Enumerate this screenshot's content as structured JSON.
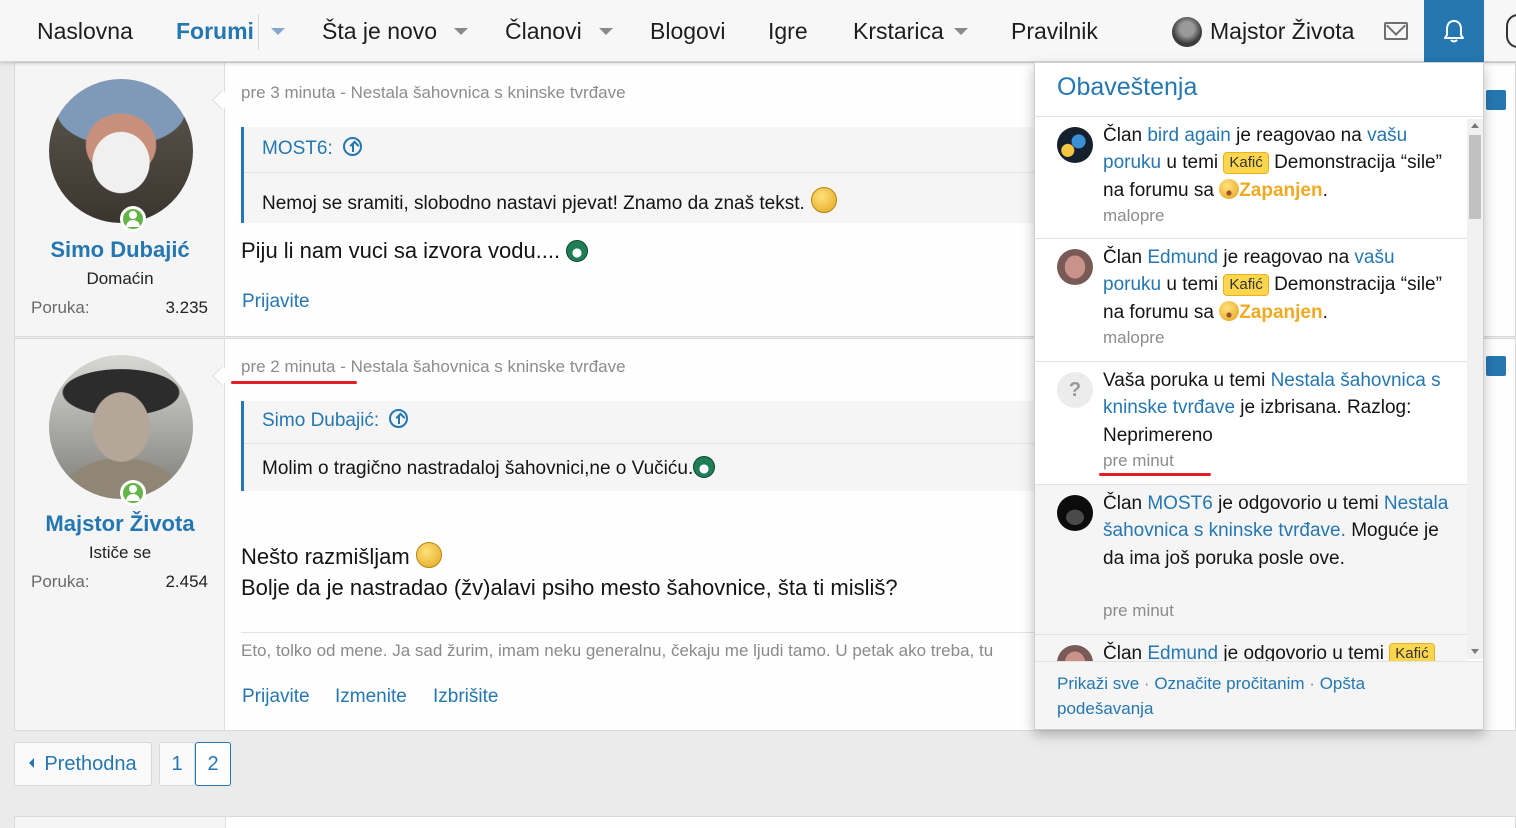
{
  "nav": {
    "items": [
      "Naslovna",
      "Forumi",
      "Šta je novo",
      "Članovi",
      "Blogovi",
      "Igre",
      "Krstarica",
      "Pravilnik"
    ],
    "user_name": "Majstor Života"
  },
  "posts": [
    {
      "author": "Simo Dubajić",
      "title": "Domaćin",
      "stat_label": "Poruka:",
      "stat_value": "3.235",
      "meta": "pre 3 minuta - Nestala šahovnica s kninske tvrđave",
      "quote_author": "MOST6:",
      "quote_text": "Nemoj se sramiti, slobodno nastavi pjevat! Znamo da znaš tekst.",
      "body": "Piju li nam vuci sa izvora vodu....",
      "actions": [
        "Prijavite"
      ]
    },
    {
      "author": "Majstor Života",
      "title": "Ističe se",
      "stat_label": "Poruka:",
      "stat_value": "2.454",
      "meta": "pre 2 minuta - Nestala šahovnica s kninske tvrđave",
      "quote_author": "Simo Dubajić:",
      "quote_text": "Molim o tragično nastradaloj šahovnici,ne o Vučiću.",
      "body_lines": [
        "Nešto razmišljam",
        "Bolje da je nastradao (žv)alavi psiho mesto šahovnice, šta ti misliš?"
      ],
      "signature": "Eto, tolko od mene. Ja sad žurim, imam neku generalnu, čekaju me ljudi tamo. U petak ako treba, tu",
      "actions": [
        "Prijavite",
        "Izmenite",
        "Izbrišite"
      ]
    }
  ],
  "pagination": {
    "prev": "Prethodna",
    "pages": [
      "1",
      "2"
    ],
    "current": "2"
  },
  "notifications": {
    "title": "Obaveštenja",
    "items": [
      {
        "member_prefix": "Član",
        "user": "bird again",
        "action": "je reagovao na",
        "link": "vašu poruku",
        "in_topic": "u temi",
        "prefix_tag": "Kafić",
        "topic": "Demonstracija “sile” na forumu sa",
        "reaction": "Zapanjen",
        "end": ".",
        "time": "malopre"
      },
      {
        "member_prefix": "Član",
        "user": "Edmund",
        "action": "je reagovao na",
        "link": "vašu poruku",
        "in_topic": "u temi",
        "prefix_tag": "Kafić",
        "topic": "Demonstracija “sile” na forumu sa",
        "reaction": "Zapanjen",
        "end": ".",
        "time": "malopre"
      },
      {
        "text_before": "Vaša poruka u temi",
        "topic_link": "Nestala šahovnica s kninske tvrđave",
        "text_after": "je izbrisana. Razlog: Neprimereno",
        "time": "pre minut"
      },
      {
        "member_prefix": "Član",
        "user": "MOST6",
        "action": "je odgovorio u temi",
        "topic_link": "Nestala šahovnica s kninske tvrđave.",
        "note": "Moguće je da ima još poruka posle ove.",
        "time": "pre minut"
      },
      {
        "member_prefix": "Član",
        "user": "Edmund",
        "action": "je odgovorio u temi",
        "prefix_tag": "Kafić"
      }
    ],
    "footer": {
      "show_all": "Prikaži sve",
      "mark_read": "Označite pročitanim",
      "settings": "Opšta podešavanja",
      "separator": "·"
    }
  },
  "colors": {
    "accent": "#2577b1",
    "annotation": "#e31e24",
    "online": "#63b549",
    "tag": "#fdd64d"
  }
}
